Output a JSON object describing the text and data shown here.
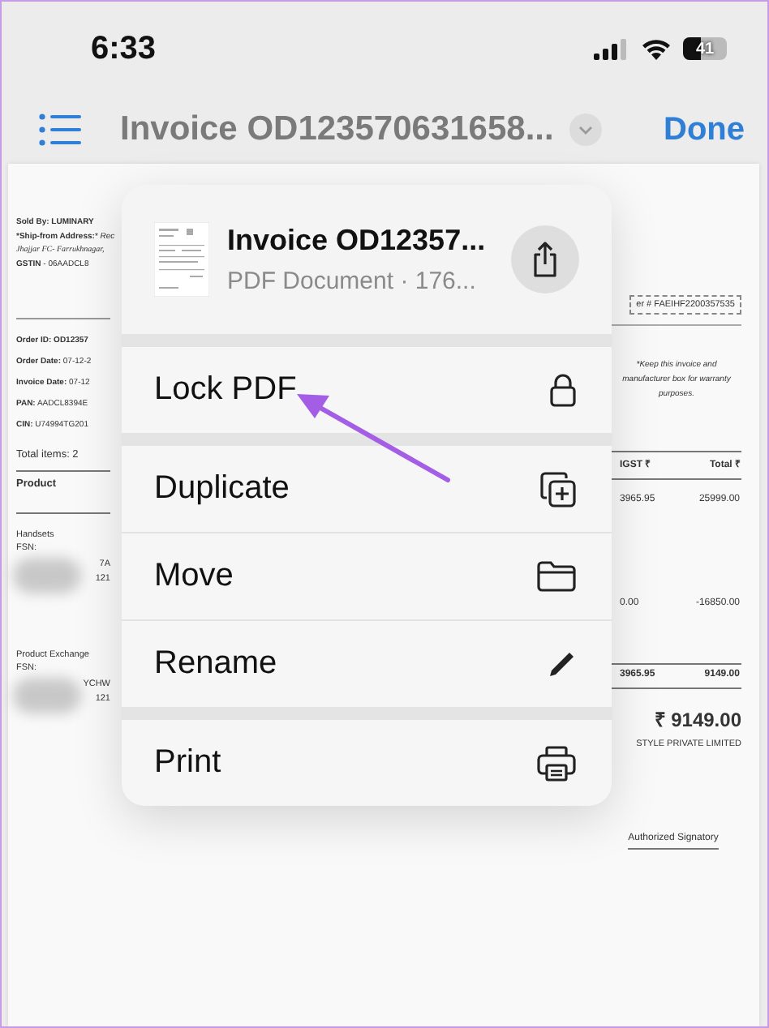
{
  "status_bar": {
    "time": "6:33",
    "battery": "41"
  },
  "nav": {
    "title": "Invoice OD123570631658...",
    "done": "Done"
  },
  "document": {
    "seller": [
      {
        "text": "Sold By: LUMINARY",
        "kind": "bold"
      },
      {
        "text": "***Ship-from Address:*** *Rec*",
        "kind": "plain"
      },
      {
        "text": "Jhajjar FC- Farrukhnagar,",
        "kind": "italic"
      },
      {
        "text": "**GSTIN** - 06AADCL8",
        "kind": "plain"
      }
    ],
    "order": [
      "**Order ID: OD12357**",
      "**Order Date:** 07-12-2",
      "**Invoice Date:** 07-12",
      "**PAN:** AADCL8394E",
      "**CIN:** U74994TG201"
    ],
    "total_items": "Total items: 2",
    "product_heading": "Product",
    "items": [
      {
        "name": "Handsets",
        "fsn": "FSN:",
        "fragments": [
          "7A",
          "121"
        ]
      },
      {
        "name": "Product Exchange",
        "fsn": "FSN:",
        "fragments": [
          "YCHW",
          "121"
        ]
      }
    ],
    "order_box": "er # FAEIHF2200357535",
    "note": "*Keep this invoice and manufacturer box for warranty purposes.",
    "columns": [
      "IGST ₹",
      "Total ₹"
    ],
    "rows": [
      [
        "3965.95",
        "25999.00"
      ],
      [
        "0.00",
        "-16850.00"
      ]
    ],
    "totals": [
      "3965.95",
      "9149.00"
    ],
    "grand_total": "₹ 9149.00",
    "company": "STYLE PRIVATE LIMITED",
    "signatory": "Authorized Signatory"
  },
  "menu": {
    "title": "Invoice OD12357...",
    "subtitle": "PDF Document · 176...",
    "groups": [
      [
        {
          "label": "Lock PDF",
          "kind": "lock"
        }
      ],
      [
        {
          "label": "Duplicate",
          "kind": "duplicate"
        },
        {
          "label": "Move",
          "kind": "folder"
        },
        {
          "label": "Rename",
          "kind": "pencil"
        }
      ],
      [
        {
          "label": "Print",
          "kind": "printer"
        }
      ]
    ]
  }
}
